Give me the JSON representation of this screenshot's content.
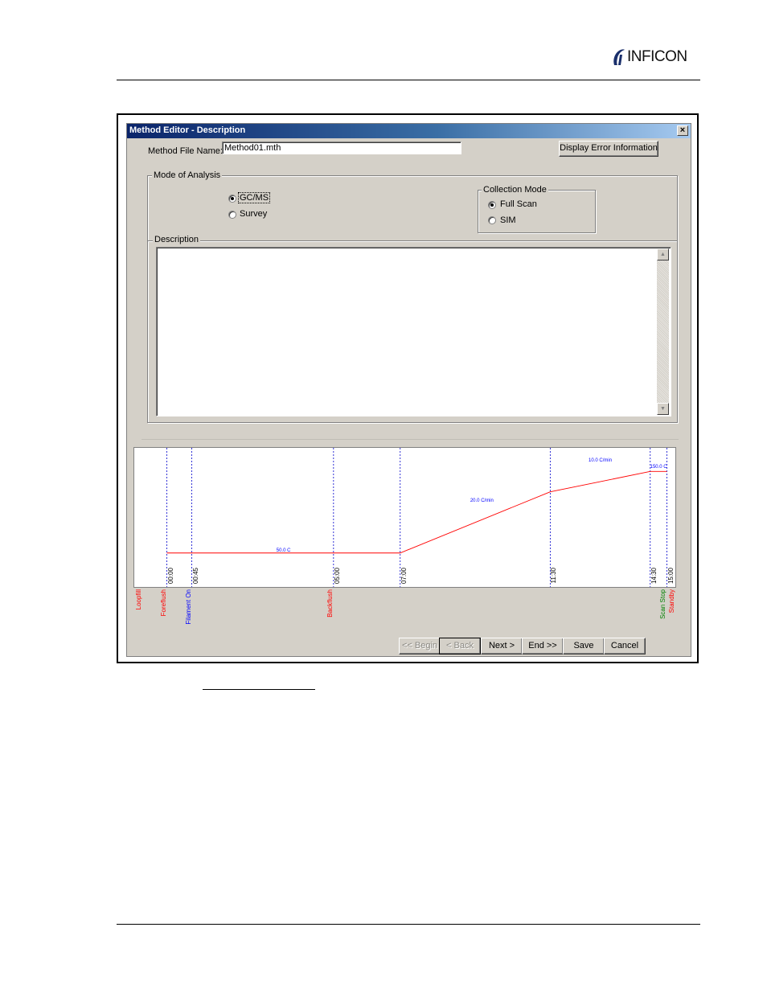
{
  "page": {
    "brand": "INFICON"
  },
  "dialog": {
    "title": "Method Editor - Description",
    "close_label": "×",
    "file_name_label": "Method File Name:",
    "file_name_value": "Method01.mth",
    "display_error_button": "Display Error Information",
    "mode_group_title": "Mode of Analysis",
    "mode_options": [
      {
        "label": "GC/MS",
        "selected": true
      },
      {
        "label": "Survey",
        "selected": false
      }
    ],
    "collection_group_title": "Collection Mode",
    "collection_options": [
      {
        "label": "Full Scan",
        "selected": true
      },
      {
        "label": "SIM",
        "selected": false
      }
    ],
    "description_label": "Description",
    "description_value": "",
    "nav_buttons": {
      "begin": "<< Begin",
      "back": "< Back",
      "next": "Next >",
      "end": "End >>",
      "save": "Save",
      "cancel": "Cancel"
    }
  },
  "chart_data": {
    "type": "line",
    "series": [
      {
        "color": "#ff0000",
        "points": [
          [
            0.0,
            50.0
          ],
          [
            7.0,
            50.0
          ],
          [
            11.5,
            140.0
          ],
          [
            14.5,
            170.0
          ],
          [
            15.0,
            170.0
          ]
        ]
      }
    ],
    "annotations": [
      {
        "text": "50.0 C",
        "color": "#0000ff"
      },
      {
        "text": "20.0 C/min",
        "color": "#0000ff"
      },
      {
        "text": "10.0 C/min",
        "color": "#0000ff"
      },
      {
        "text": "150.0 C",
        "color": "#0000ff"
      }
    ],
    "time_markers": [
      {
        "time": 0.0,
        "label": "00:00"
      },
      {
        "time": 0.75,
        "label": "00:45"
      },
      {
        "time": 5.0,
        "label": "05:00"
      },
      {
        "time": 7.0,
        "label": "07:00"
      },
      {
        "time": 11.5,
        "label": "11:30"
      },
      {
        "time": 14.5,
        "label": "14:30"
      },
      {
        "time": 15.0,
        "label": "15:00"
      }
    ],
    "events": [
      {
        "label": "Loopfill",
        "color": "#ff0000",
        "time": -1.0
      },
      {
        "label": "Foreflush",
        "color": "#ff0000",
        "time": 0.0
      },
      {
        "label": "Filament On",
        "color": "#0000ff",
        "time": 0.75
      },
      {
        "label": "Backflush",
        "color": "#ff0000",
        "time": 5.0
      },
      {
        "label": "Scan Stop",
        "color": "#008000",
        "time": 14.5
      },
      {
        "label": "Standby",
        "color": "#ff0000",
        "time": 15.0
      }
    ],
    "xlim": [
      -1.0,
      15.3
    ],
    "ylim": [
      0,
      200
    ],
    "grid": false
  }
}
